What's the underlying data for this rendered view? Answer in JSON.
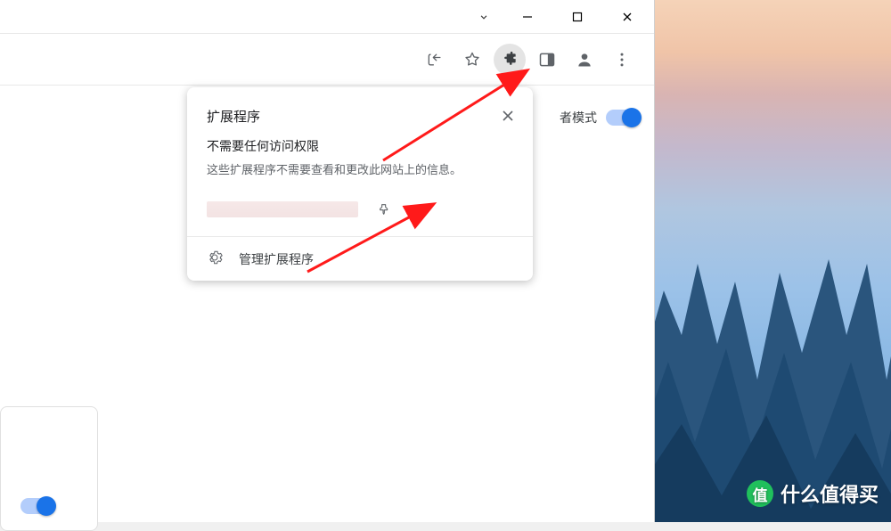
{
  "window_controls": {
    "dropdown": "⌄",
    "minimize": "—",
    "maximize": "▢",
    "close": "✕"
  },
  "toolbar": {
    "share": "share-icon",
    "bookmark": "star-icon",
    "extensions": "puzzle-icon",
    "panel": "panel-icon",
    "profile": "person-icon",
    "menu": "kebab-icon"
  },
  "devmode": {
    "label_suffix": "者模式",
    "enabled": true
  },
  "popup": {
    "title": "扩展程序",
    "subtitle": "不需要任何访问权限",
    "description": "这些扩展程序不需要查看和更改此网站上的信息。",
    "manage_label": "管理扩展程序"
  },
  "watermark": {
    "badge": "值",
    "text": "什么值得买"
  },
  "colors": {
    "accent": "#1a73e8",
    "arrow": "#ff1a1a",
    "icon": "#5f6368",
    "smzdm_green": "#20c05c"
  }
}
